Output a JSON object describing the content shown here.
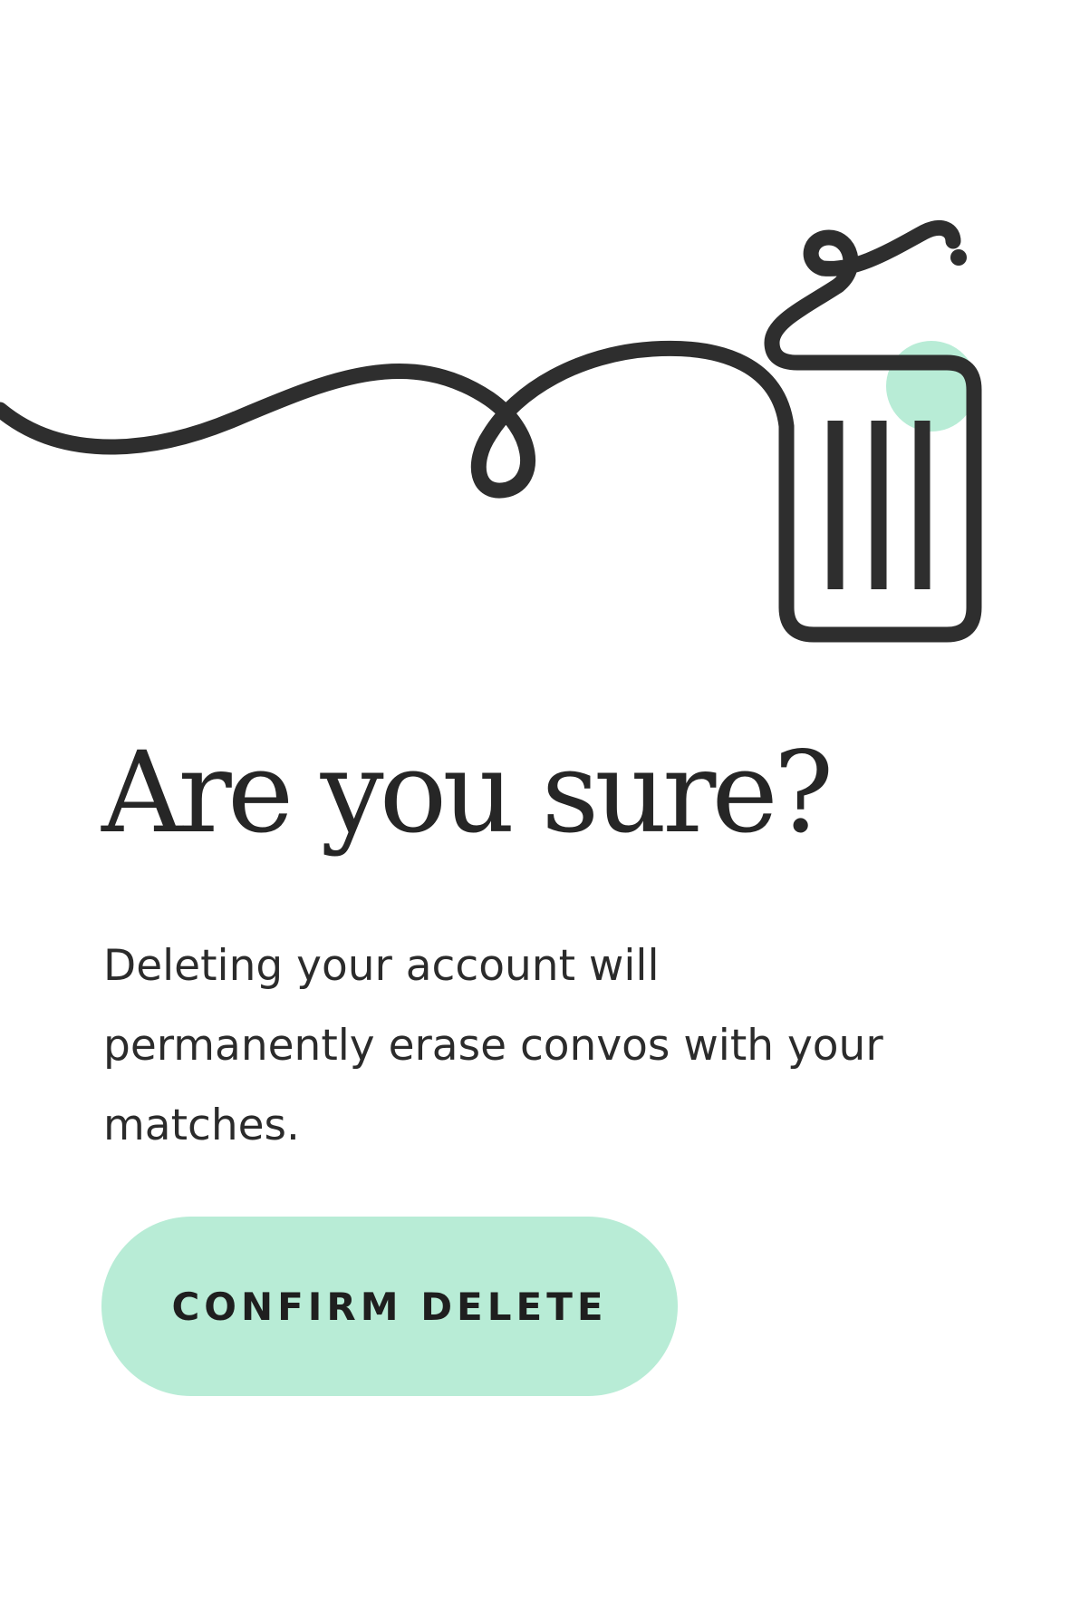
{
  "screen": {
    "title": "Are you sure?",
    "message": "Deleting your account will permanently erase convos with your matches.",
    "confirm_button_label": "CONFIRM DELETE"
  },
  "illustration": {
    "icon": "trash-can-icon",
    "line_color": "#2e2e2e",
    "accent_color": "#b8ecd6"
  },
  "colors": {
    "button_background": "#b8ecd6",
    "text": "#2b2b2b",
    "background": "#ffffff"
  }
}
